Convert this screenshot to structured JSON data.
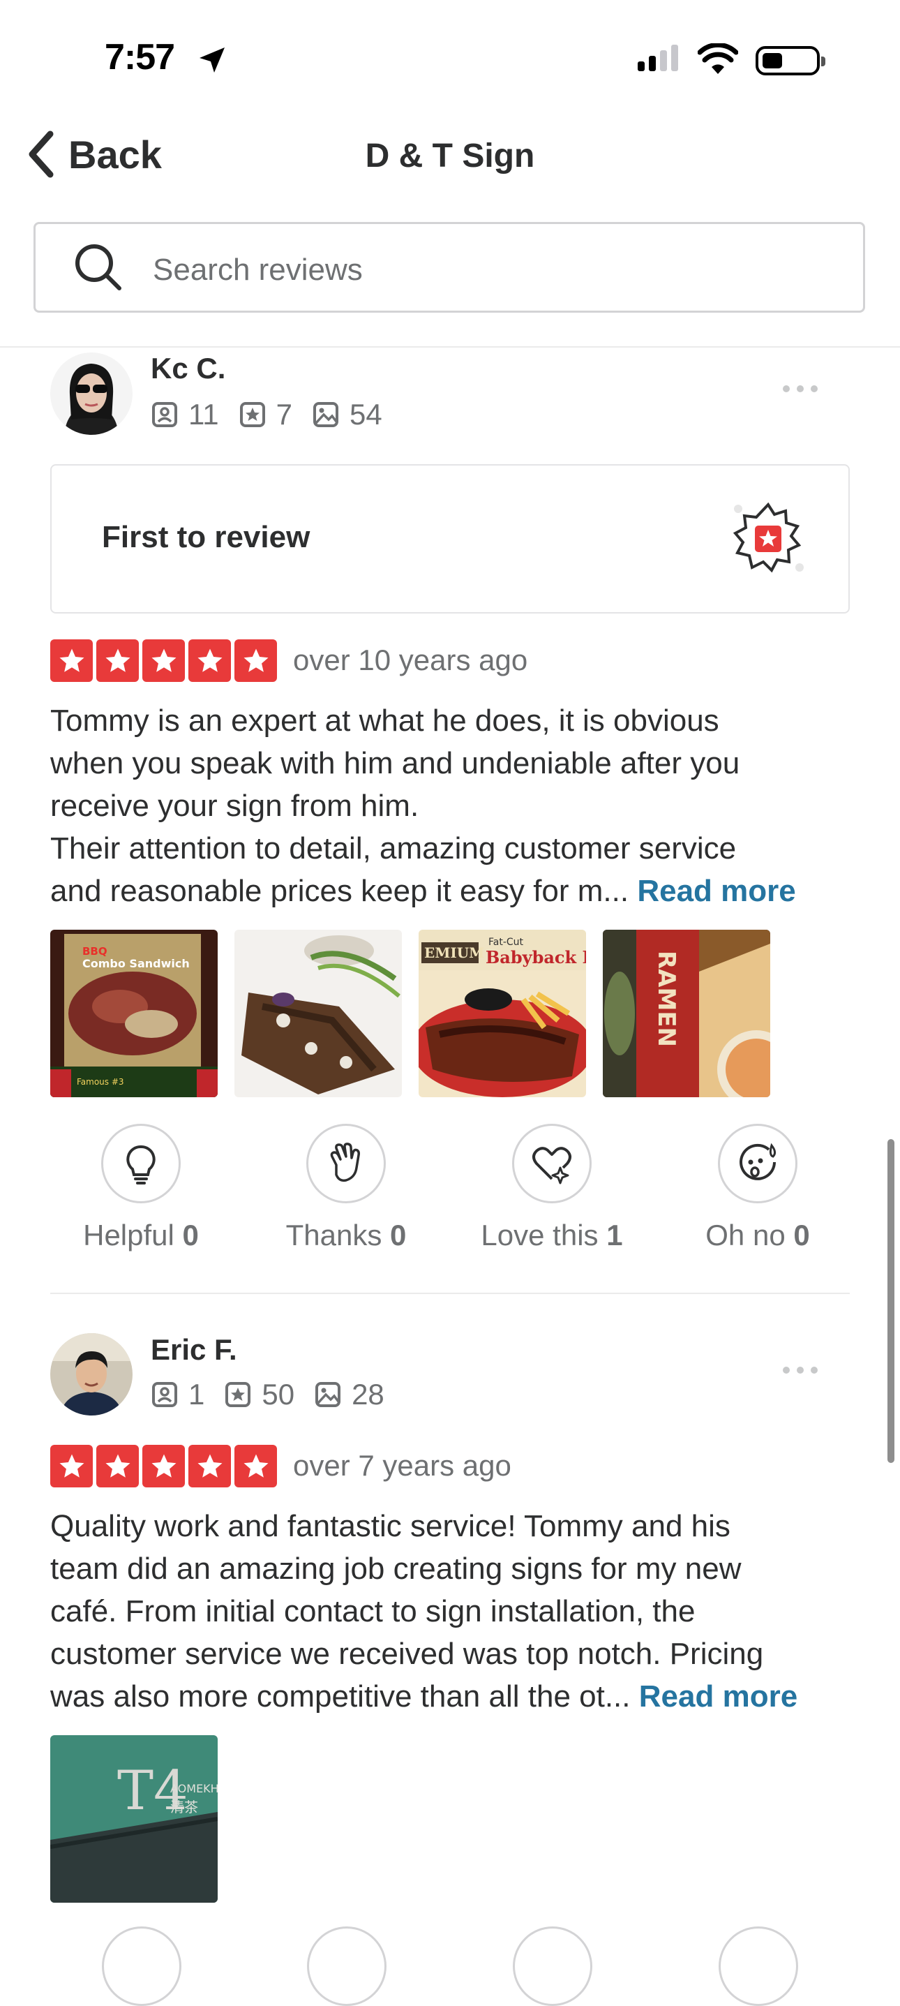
{
  "status_bar": {
    "time": "7:57"
  },
  "nav": {
    "back_label": "Back",
    "title": "D & T Sign"
  },
  "search": {
    "placeholder": "Search reviews"
  },
  "reviews": [
    {
      "name": "Kc C.",
      "reviews_count": "11",
      "friends_count": "7",
      "photos_count": "54",
      "badge": "First to review",
      "rating": 5,
      "date": "over 10 years ago",
      "text_lines": [
        "Tommy is an expert at what he does, it is obvious",
        "when you speak with him and undeniable after you",
        "receive your sign from him.",
        "Their attention to detail, amazing customer service",
        "and reasonable prices keep it easy for m..."
      ],
      "read_more": "Read more",
      "photos": [
        {
          "line1": "BBQ",
          "line2": "Combo Sandwich",
          "line3": "Famous #3"
        },
        {
          "caption": ""
        },
        {
          "line1": "Fat-Cut",
          "line2": "Babyback R",
          "line3": "EMIUM"
        },
        {
          "line1": "RAMEN"
        }
      ],
      "reactions": [
        {
          "label": "Helpful",
          "count": "0"
        },
        {
          "label": "Thanks",
          "count": "0"
        },
        {
          "label": "Love this",
          "count": "1"
        },
        {
          "label": "Oh no",
          "count": "0"
        }
      ]
    },
    {
      "name": "Eric F.",
      "reviews_count": "1",
      "friends_count": "50",
      "photos_count": "28",
      "rating": 5,
      "date": "over 7 years ago",
      "text_lines": [
        "Quality work and fantastic service! Tommy and his",
        "team did an amazing job creating signs for my new",
        "café. From initial contact to sign installation, the",
        "customer service we received was top notch. Pricing",
        "was also more competitive than all the ot..."
      ],
      "read_more": "Read more",
      "photos": [
        {
          "line1": "T4",
          "line2": "AOMEKH",
          "line3": "清茶"
        }
      ]
    }
  ],
  "colors": {
    "star_red": "#e83a3a",
    "link_blue": "#2574a0",
    "text_dark": "#2d2e2f",
    "text_muted": "#6e7072"
  }
}
